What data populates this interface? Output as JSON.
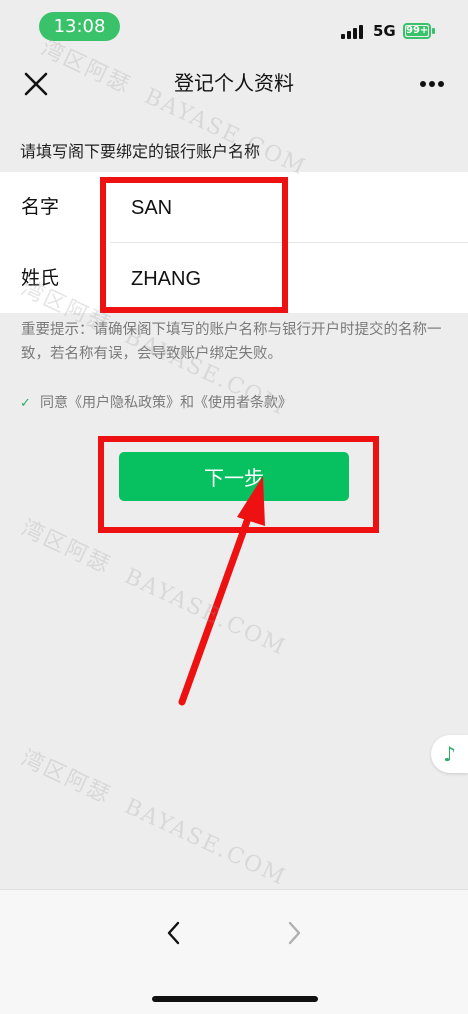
{
  "status_bar": {
    "time": "13:08",
    "network": "5G",
    "battery": "99+"
  },
  "nav": {
    "title": "登记个人资料"
  },
  "form": {
    "section_header": "请填写阁下要绑定的银行账户名称",
    "first_name_label": "名字",
    "first_name_value": "SAN",
    "last_name_label": "姓氏",
    "last_name_value": "ZHANG"
  },
  "notice": "重要提示：请确保阁下填写的账户名称与银行开户时提交的名称一致，若名称有误，会导致账户绑定失败。",
  "agreement": {
    "checkmark": "✓",
    "text": "同意《用户隐私政策》和《使用者条款》"
  },
  "next_button": {
    "label": "下一步"
  },
  "music_icon": "♪",
  "watermark": {
    "line1": "湾区阿瑟",
    "line2": "BAYASE.COM"
  },
  "colors": {
    "accent": "#07c160",
    "annotation": "#ee1111",
    "status_pill": "#3ac26a"
  }
}
